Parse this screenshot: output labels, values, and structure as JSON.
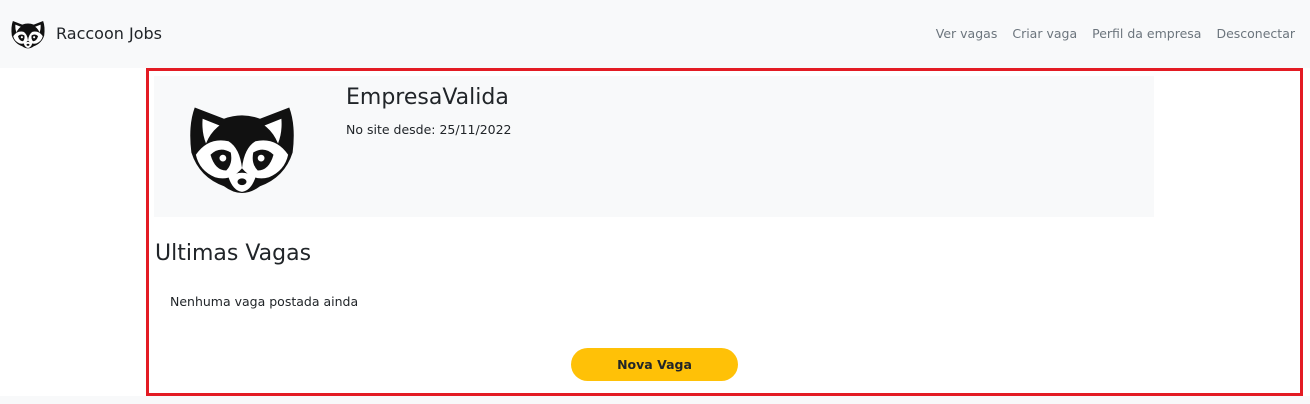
{
  "navbar": {
    "brand_name": "Raccoon Jobs",
    "brand_icon": "raccoon-logo-icon",
    "links": [
      "Ver vagas",
      "Criar vaga",
      "Perfil da empresa",
      "Desconectar"
    ]
  },
  "profile": {
    "logo_icon": "raccoon-logo-icon",
    "company_name": "EmpresaValida",
    "since_text": "No site desde: 25/11/2022"
  },
  "jobs": {
    "title": "Ultimas Vagas",
    "empty_text": "Nenhuma vaga postada ainda",
    "new_button_label": "Nova Vaga"
  },
  "colors": {
    "navbar_bg": "#f8f9fa",
    "highlight_border": "#e31b23",
    "button_bg": "#ffc107",
    "nav_link": "#6c757d"
  }
}
